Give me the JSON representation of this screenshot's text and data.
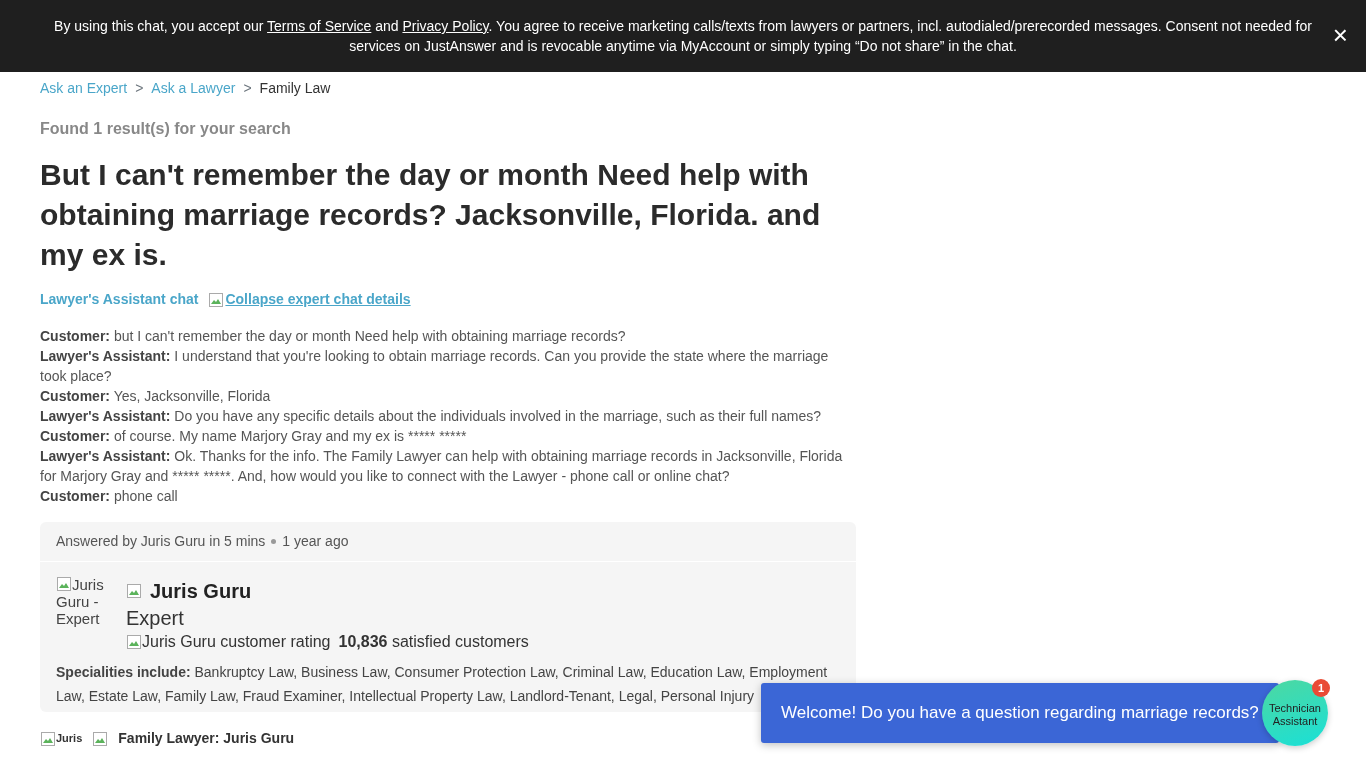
{
  "consent_banner": {
    "segments": [
      {
        "text": "By using this chat, you accept our",
        "link": false
      },
      {
        "text": "Terms of Service",
        "link": true
      },
      {
        "text": "and",
        "link": false
      },
      {
        "text": "Privacy Policy",
        "link": true
      },
      {
        "text": ". You agree to receive marketing calls/texts from lawyers or partners, incl. autodialed/prerecorded messages. Consent not needed for services on JustAnswer and is revocable anytime via MyAccount or simply typing “Do not share” in the chat.",
        "link": false
      }
    ],
    "close": "×"
  },
  "breadcrumb": [
    {
      "label": "Ask an Expert",
      "link": true
    },
    {
      "label": "Ask a Lawyer",
      "link": true
    },
    {
      "label": "Family Law",
      "link": false
    }
  ],
  "breadcrumb_separator": ">",
  "results_note": "Found 1 result(s) for your search",
  "title": "But I can't remember the day or month Need help with obtaining marriage records? Jacksonville, Florida. and my ex is.",
  "chat_header": {
    "label": "Lawyer's Assistant chat",
    "toggle_alt": "Collapse expert chat details"
  },
  "messages": [
    {
      "speaker": "Customer:",
      "text": "but I can't remember the day or month Need help with obtaining marriage records?"
    },
    {
      "speaker": "Lawyer's Assistant:",
      "text": "I understand that you're looking to obtain marriage records. Can you provide the state where the marriage took place?"
    },
    {
      "speaker": "Customer:",
      "text": "Yes, Jacksonville, Florida"
    },
    {
      "speaker": "Lawyer's Assistant:",
      "text": "Do you have any specific details about the individuals involved in the marriage, such as their full names?"
    },
    {
      "speaker": "Customer:",
      "text": "of course. My name Marjory Gray and my ex is ***** *****"
    },
    {
      "speaker": "Lawyer's Assistant:",
      "text": "Ok. Thanks for the info. The Family Lawyer can help with obtaining marriage records in Jacksonville, Florida for Marjory Gray and ***** *****. And, how would you like to connect with the Lawyer - phone call or online chat?"
    },
    {
      "speaker": "Customer:",
      "text": "phone call"
    }
  ],
  "answer_card": {
    "answered_by": "Answered by Juris Guru in 5 mins",
    "time_ago": "1 year ago",
    "avatar_alt": "Juris Guru - Expert",
    "name": "Juris Guru",
    "role": "Expert",
    "rating_alt": "Juris Guru customer rating",
    "satisfied": "**10,836** satisfied customers",
    "specialities": "**Specialities include:** Bankruptcy Law, Business Law, Consumer Protection Law, Criminal Law, Education Law, Employment Law, Estate Law, Family Law, Fraud Examiner, Intellectual Property Law, Landlord-Tenant, Legal, Personal Injury"
  },
  "answer_author": {
    "avatar_alt": "Juris",
    "label": "Family Lawyer: Juris Guru"
  },
  "chat_popup": {
    "message": "Welcome! Do you have a question regarding marriage records?",
    "avatar_alt": "Technician Assistant",
    "badge": "1"
  }
}
